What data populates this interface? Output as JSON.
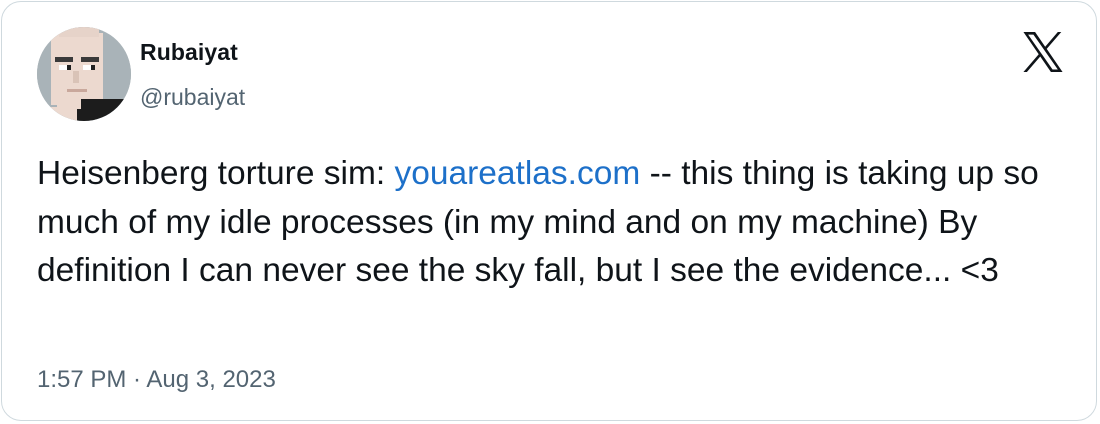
{
  "author": {
    "name": "Rubaiyat",
    "handle": "@rubaiyat",
    "avatar_icon": "pixel-face-avatar"
  },
  "brand": {
    "logo_icon": "x-logo-icon",
    "color": "#0f1419"
  },
  "tweet": {
    "text_before_link": "Heisenberg torture sim: ",
    "link_text": "youareatlas.com",
    "text_after_link": " -- this thing is taking up so much of my idle processes (in my mind and on my machine) By definition I can never see the sky fall, but I see the evidence... <3"
  },
  "meta": {
    "timestamp": "1:57 PM · Aug 3, 2023"
  },
  "colors": {
    "link": "#1d70c9",
    "secondary_text": "#536471",
    "border": "#cfd9de"
  }
}
